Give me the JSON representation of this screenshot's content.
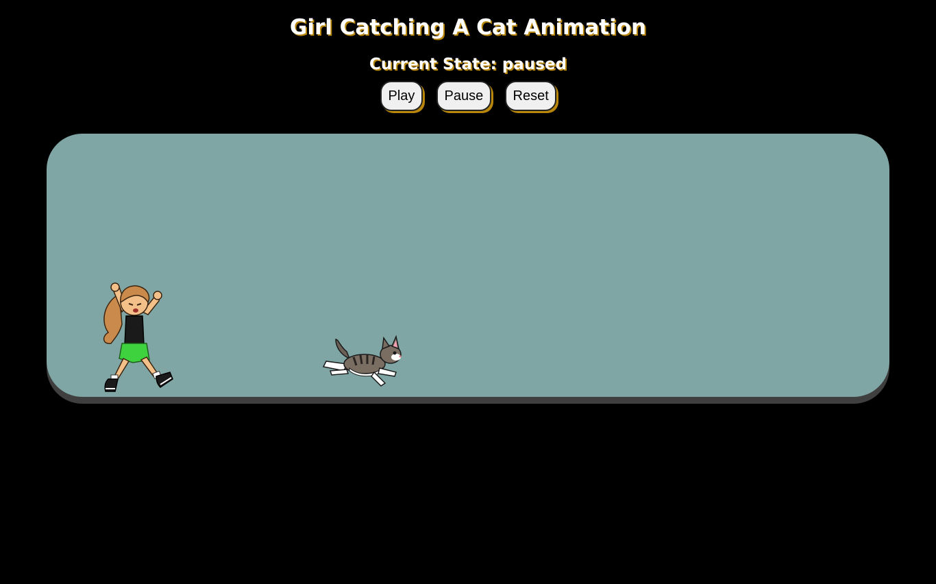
{
  "title": "Girl Catching A Cat Animation",
  "state": {
    "label": "Current State:",
    "value": "paused"
  },
  "controls": {
    "play_label": "Play",
    "pause_label": "Pause",
    "reset_label": "Reset"
  },
  "colors": {
    "background": "#000000",
    "stage": "#7fa6a5",
    "stage_shadow": "#3f3f3f",
    "text_shadow": "#b8860b",
    "button_face": "#f0f0f0"
  },
  "icons": {
    "girl": "running-girl-sprite",
    "cat": "running-cat-sprite"
  }
}
